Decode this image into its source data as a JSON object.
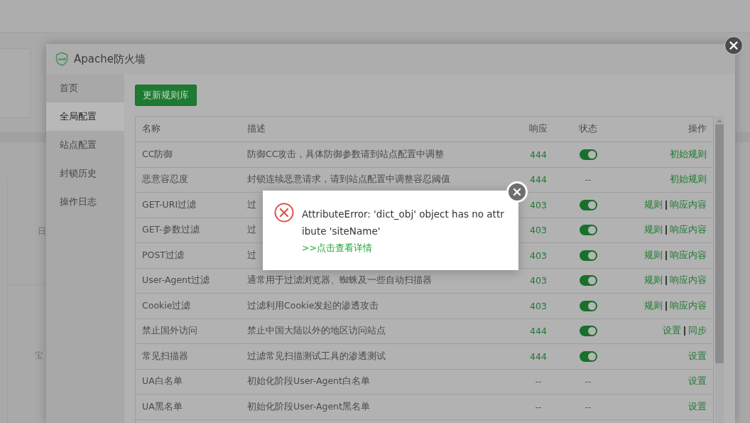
{
  "background": {
    "labels": [
      "日",
      "宝"
    ]
  },
  "window": {
    "title": "Apache防火墙"
  },
  "sidebar": {
    "items": [
      {
        "label": "首页",
        "selected": false
      },
      {
        "label": "全局配置",
        "selected": true
      },
      {
        "label": "站点配置",
        "selected": false
      },
      {
        "label": "封锁历史",
        "selected": false
      },
      {
        "label": "操作日志",
        "selected": false
      }
    ]
  },
  "toolbar": {
    "button": "更新规则库"
  },
  "table": {
    "columns": [
      "名称",
      "描述",
      "响应",
      "状态",
      "操作"
    ],
    "rows": [
      {
        "name": "CC防御",
        "description": "防御CC攻击，具体防御参数请到站点配置中调整",
        "response": "444",
        "status": {
          "kind": "toggle",
          "on": true
        },
        "actions": [
          "初始规则"
        ]
      },
      {
        "name": "恶意容忍度",
        "description": "封锁连续恶意请求，请到站点配置中调整容忍阈值",
        "response": "444",
        "status": {
          "kind": "text",
          "text": "--"
        },
        "actions": [
          "初始规则"
        ]
      },
      {
        "name": "GET-URI过滤",
        "description": "过",
        "response": "403",
        "status": {
          "kind": "toggle",
          "on": true
        },
        "actions": [
          "规则",
          "响应内容"
        ]
      },
      {
        "name": "GET-参数过滤",
        "description": "过",
        "response": "403",
        "status": {
          "kind": "toggle",
          "on": true
        },
        "actions": [
          "规则",
          "响应内容"
        ]
      },
      {
        "name": "POST过滤",
        "description": "过",
        "response": "403",
        "status": {
          "kind": "toggle",
          "on": true
        },
        "actions": [
          "规则",
          "响应内容"
        ]
      },
      {
        "name": "User-Agent过滤",
        "description": "通常用于过滤浏览器、蜘蛛及一些自动扫描器",
        "response": "403",
        "status": {
          "kind": "toggle",
          "on": true
        },
        "actions": [
          "规则",
          "响应内容"
        ]
      },
      {
        "name": "Cookie过滤",
        "description": "过滤利用Cookie发起的渗透攻击",
        "response": "403",
        "status": {
          "kind": "toggle",
          "on": true
        },
        "actions": [
          "规则",
          "响应内容"
        ]
      },
      {
        "name": "禁止国外访问",
        "description": "禁止中国大陆以外的地区访问站点",
        "response": "444",
        "status": {
          "kind": "toggle",
          "on": true
        },
        "actions": [
          "设置",
          "同步"
        ]
      },
      {
        "name": "常见扫描器",
        "description": "过滤常见扫描测试工具的渗透测试",
        "response": "444",
        "status": {
          "kind": "toggle",
          "on": true
        },
        "actions": [
          "设置"
        ]
      },
      {
        "name": "UA白名单",
        "description": "初始化阶段User-Agent白名单",
        "response": "--",
        "status": {
          "kind": "text",
          "text": "--"
        },
        "actions": [
          "设置"
        ]
      },
      {
        "name": "UA黑名单",
        "description": "初始化阶段User-Agent黑名单",
        "response": "--",
        "status": {
          "kind": "text",
          "text": "--"
        },
        "actions": [
          "设置"
        ]
      }
    ]
  },
  "dialog": {
    "message": "AttributeError: 'dict_obj' object has no attribute 'siteName'",
    "link": ">>点击查看详情"
  }
}
